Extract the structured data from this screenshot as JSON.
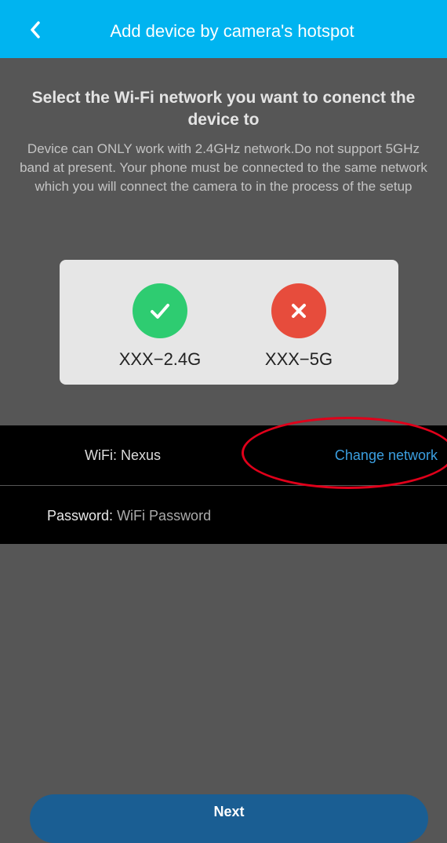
{
  "header": {
    "title": "Add device by camera's hotspot",
    "back_icon": "chevron-left-icon",
    "color": "#00b4f0"
  },
  "instructions": {
    "heading": "Select the Wi-Fi network you want to conenct the device to",
    "description": "Device can ONLY work with 2.4GHz network.Do not support 5GHz band at present. Your phone must be connected to the same network which you will connect the camera to in the process of the setup"
  },
  "band_card": {
    "supported": {
      "label": "XXX−2.4G",
      "icon": "check-icon",
      "color": "#2ecc71"
    },
    "unsupported": {
      "label": "XXX−5G",
      "icon": "close-icon",
      "color": "#e74c3c"
    }
  },
  "wifi": {
    "label": "WiFi: Nexus",
    "change_label": "Change network",
    "link_color": "#3b9fe0"
  },
  "password": {
    "label": "Password:",
    "placeholder": "WiFi Password"
  },
  "footer": {
    "next_label": "Next",
    "color": "#1a5e93"
  },
  "annotation": {
    "color": "#e0001a"
  }
}
